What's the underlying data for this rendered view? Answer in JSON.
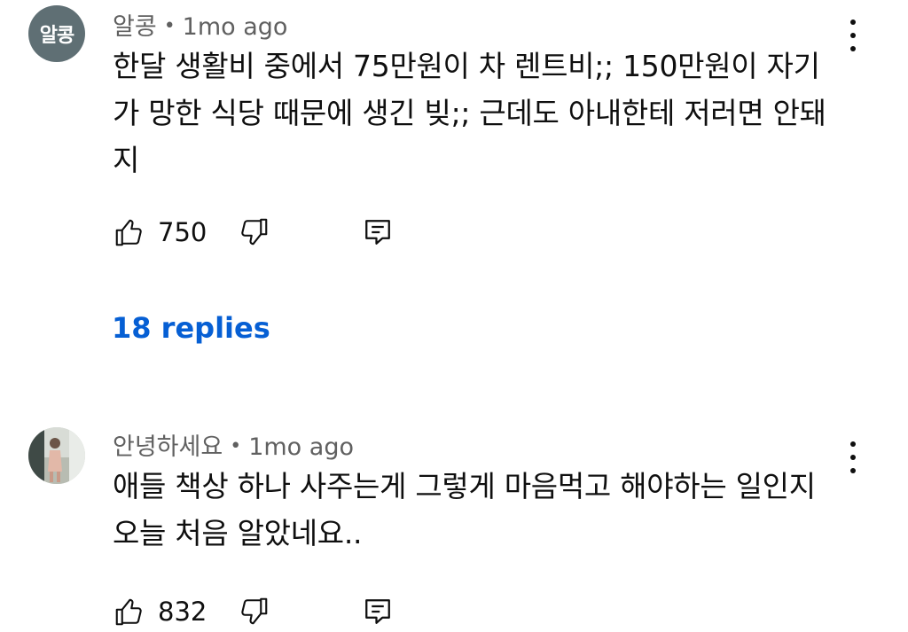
{
  "comments": [
    {
      "avatar_text": "알콩",
      "author": "알콩",
      "time": "1mo ago",
      "separator": "•",
      "text": "한달 생활비 중에서 75만원이 차 렌트비;; 150만원이 자기가 망한 식당 때문에 생긴 빚;; 근데도 아내한테 저러면 안돼지",
      "likes": "750",
      "replies_label": "18 replies"
    },
    {
      "author": "안녕하세요",
      "time": "1mo ago",
      "separator": "•",
      "text": "애들 책상 하나 사주는게 그렇게 마음먹고 해야하는 일인지 오늘 처음 알았네요..",
      "likes": "832"
    }
  ],
  "icons": {
    "like": "thumbs-up-icon",
    "dislike": "thumbs-down-icon",
    "reply": "comment-reply-icon",
    "more": "more-vertical-icon"
  },
  "colors": {
    "replies_link": "#065fd4",
    "meta_text": "#606060",
    "avatar_bg": "#5f6f74"
  }
}
